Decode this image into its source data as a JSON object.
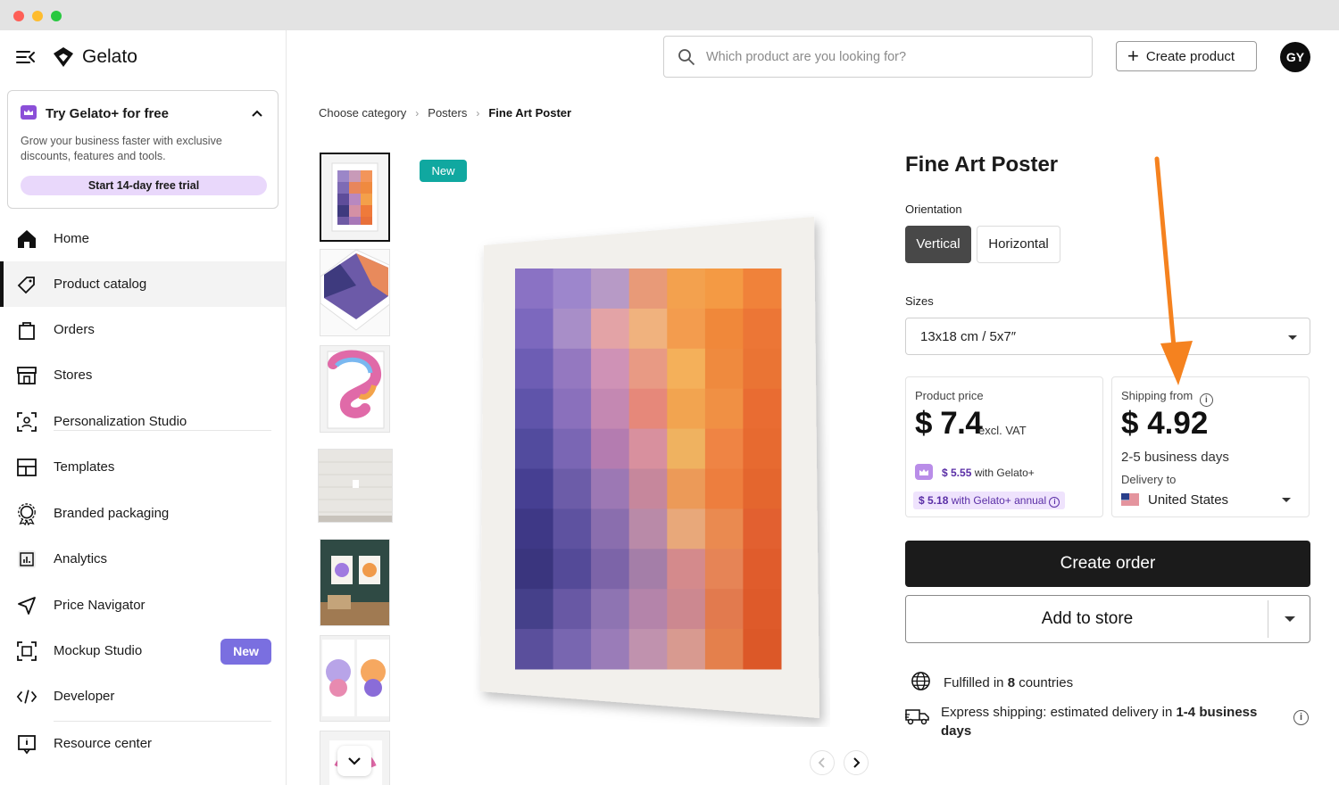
{
  "sidebar": {
    "brand": "Gelato",
    "promo": {
      "title": "Try Gelato+ for free",
      "description": "Grow your business faster with exclusive discounts, features and tools.",
      "cta": "Start 14-day free trial"
    },
    "items": [
      {
        "label": "Home",
        "icon": "home-icon"
      },
      {
        "label": "Product catalog",
        "icon": "tag-icon",
        "active": true
      },
      {
        "label": "Orders",
        "icon": "shopping-bag-icon"
      },
      {
        "label": "Stores",
        "icon": "store-icon"
      },
      {
        "label": "Personalization Studio",
        "icon": "personalization-icon"
      },
      {
        "label": "Templates",
        "icon": "template-icon"
      },
      {
        "label": "Branded packaging",
        "icon": "badge-icon"
      },
      {
        "label": "Analytics",
        "icon": "analytics-icon"
      },
      {
        "label": "Price Navigator",
        "icon": "navigation-arrow-icon"
      },
      {
        "label": "Mockup Studio",
        "icon": "mockup-icon",
        "badge": "New"
      },
      {
        "label": "Developer",
        "icon": "code-icon"
      },
      {
        "label": "Resource center",
        "icon": "help-icon"
      }
    ]
  },
  "header": {
    "search_placeholder": "Which product are you looking for?",
    "create_product": "Create product",
    "avatar_initials": "GY"
  },
  "breadcrumb": [
    "Choose category",
    "Posters",
    "Fine Art Poster"
  ],
  "gallery": {
    "new_tag": "New",
    "thumbnail_count": 7
  },
  "product": {
    "title": "Fine Art Poster",
    "orientation_label": "Orientation",
    "orientation_options": [
      "Vertical",
      "Horizontal"
    ],
    "orientation_selected": "Vertical",
    "sizes_label": "Sizes",
    "size_selected": "13x18 cm / 5x7″",
    "price": {
      "caption": "Product price",
      "amount": "$ 7.4",
      "suffix": "excl. VAT",
      "gelato_plus_price": "$ 5.55",
      "gelato_plus_text": "with Gelato+",
      "gelato_plus_annual_price": "$ 5.18",
      "gelato_plus_annual_text": "with Gelato+ annual"
    },
    "shipping": {
      "caption": "Shipping from",
      "amount": "$ 4.92",
      "days": "2-5 business days",
      "delivery_to_label": "Delivery to",
      "country": "United States"
    },
    "create_order": "Create order",
    "add_to_store": "Add to store",
    "fulfilled_prefix": "Fulfilled in",
    "fulfilled_count": "8",
    "fulfilled_suffix": "countries",
    "express_prefix": "Express shipping: estimated delivery in",
    "express_range": "1-4 business days"
  },
  "colors": {
    "accent_annotation": "#f5821f",
    "new_badge": "#10a8a0",
    "primary_button": "#1b1b1b"
  }
}
